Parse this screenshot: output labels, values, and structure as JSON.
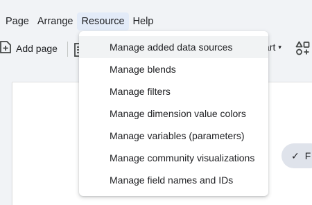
{
  "menubar": {
    "items": [
      {
        "label": "Page"
      },
      {
        "label": "Arrange"
      },
      {
        "label": "Resource"
      },
      {
        "label": "Help"
      }
    ]
  },
  "toolbar": {
    "add_page_label": "Add page",
    "add_page_icon": "add-page-icon",
    "chart_label": "art",
    "chart_caret": "▾",
    "add_control_icon": "add-control-icon"
  },
  "dropdown": {
    "items": [
      {
        "label": "Manage added data sources"
      },
      {
        "label": "Manage blends"
      },
      {
        "label": "Manage filters"
      },
      {
        "label": "Manage dimension value colors"
      },
      {
        "label": "Manage variables (parameters)"
      },
      {
        "label": "Manage community visualizations"
      },
      {
        "label": "Manage field names and IDs"
      }
    ]
  },
  "pill": {
    "check": "✓",
    "label": "F"
  },
  "colors": {
    "active_menu_bg": "#e3ebf8",
    "hover_item_bg": "#f1f3f4",
    "page_bg": "#f1f3f6"
  }
}
